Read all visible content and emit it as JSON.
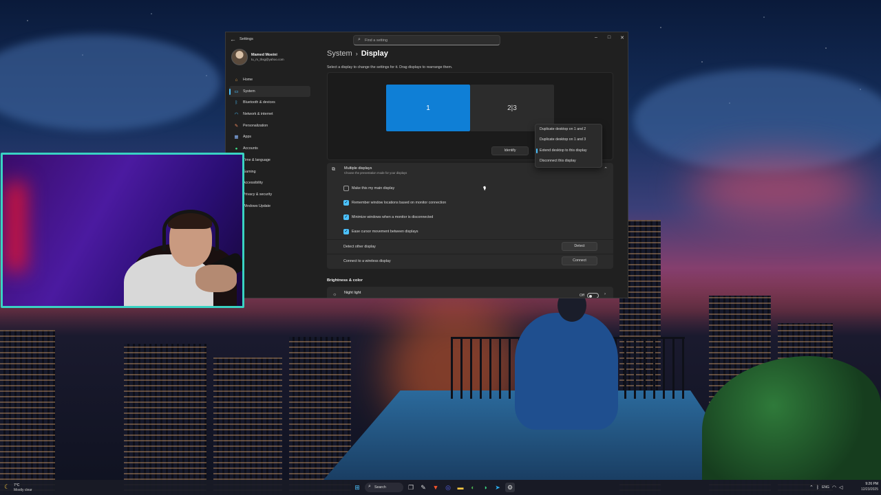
{
  "window": {
    "app_title": "Settings",
    "search_placeholder": "Find a setting",
    "controls": {
      "minimize": "–",
      "maximize": "□",
      "close": "✕"
    }
  },
  "profile": {
    "name": "Mamed Moeini",
    "email": "tu_m_thsg@yahoo.com"
  },
  "sidebar": {
    "items": [
      {
        "label": "Home",
        "icon": "home-icon",
        "color": "#e7a04a"
      },
      {
        "label": "System",
        "icon": "monitor-icon",
        "color": "#4cc2ff",
        "active": true
      },
      {
        "label": "Bluetooth & devices",
        "icon": "bluetooth-icon",
        "color": "#4cc2ff"
      },
      {
        "label": "Network & internet",
        "icon": "wifi-icon",
        "color": "#4cc2ff"
      },
      {
        "label": "Personalization",
        "icon": "brush-icon",
        "color": "#f08a5d"
      },
      {
        "label": "Apps",
        "icon": "apps-icon",
        "color": "#8ab4f8"
      },
      {
        "label": "Accounts",
        "icon": "person-icon",
        "color": "#3ddc84"
      },
      {
        "label": "Time & language",
        "icon": "clock-icon",
        "color": "#4cc2ff"
      },
      {
        "label": "Gaming",
        "icon": "gamepad-icon",
        "color": "#aaa"
      },
      {
        "label": "Accessibility",
        "icon": "accessibility-icon",
        "color": "#4cc2ff"
      },
      {
        "label": "Privacy & security",
        "icon": "shield-icon",
        "color": "#aaa"
      },
      {
        "label": "Windows Update",
        "icon": "update-icon",
        "color": "#4cc2ff"
      }
    ]
  },
  "main": {
    "breadcrumb": {
      "parent": "System",
      "separator": "›",
      "current": "Display"
    },
    "instruction": "Select a display to change the settings for it. Drag displays to rearrange them.",
    "monitors": {
      "primary": "1",
      "secondary": "2|3"
    },
    "identify_label": "Identify",
    "display_menu": {
      "items": [
        {
          "label": "Duplicate desktop on 1 and 2"
        },
        {
          "label": "Duplicate desktop on 1 and 3"
        },
        {
          "label": "Extend desktop to this display",
          "selected": true
        },
        {
          "label": "Disconnect this display"
        }
      ]
    },
    "multiple_displays": {
      "title": "Multiple displays",
      "subtitle": "Choose the presentation mode for your displays",
      "options": [
        {
          "label": "Make this my main display",
          "checked": false
        },
        {
          "label": "Remember window locations based on monitor connection",
          "checked": true
        },
        {
          "label": "Minimize windows when a monitor is disconnected",
          "checked": true
        },
        {
          "label": "Ease cursor movement between displays",
          "checked": true
        }
      ],
      "detect_label": "Detect other display",
      "detect_button": "Detect",
      "wireless_label": "Connect to a wireless display",
      "connect_button": "Connect"
    },
    "brightness_section": "Brightness & color",
    "night_light": {
      "label": "Night light",
      "state": "Off"
    }
  },
  "taskbar": {
    "weather": {
      "temp": "7°C",
      "condition": "Mostly clear"
    },
    "search_label": "Search",
    "language": "ENG",
    "time": "9:26 PM",
    "date": "12/23/2025"
  },
  "colors": {
    "accent": "#4cc2ff",
    "primary_monitor": "#0f7fd6",
    "webcam_border": "#39d3c3"
  }
}
